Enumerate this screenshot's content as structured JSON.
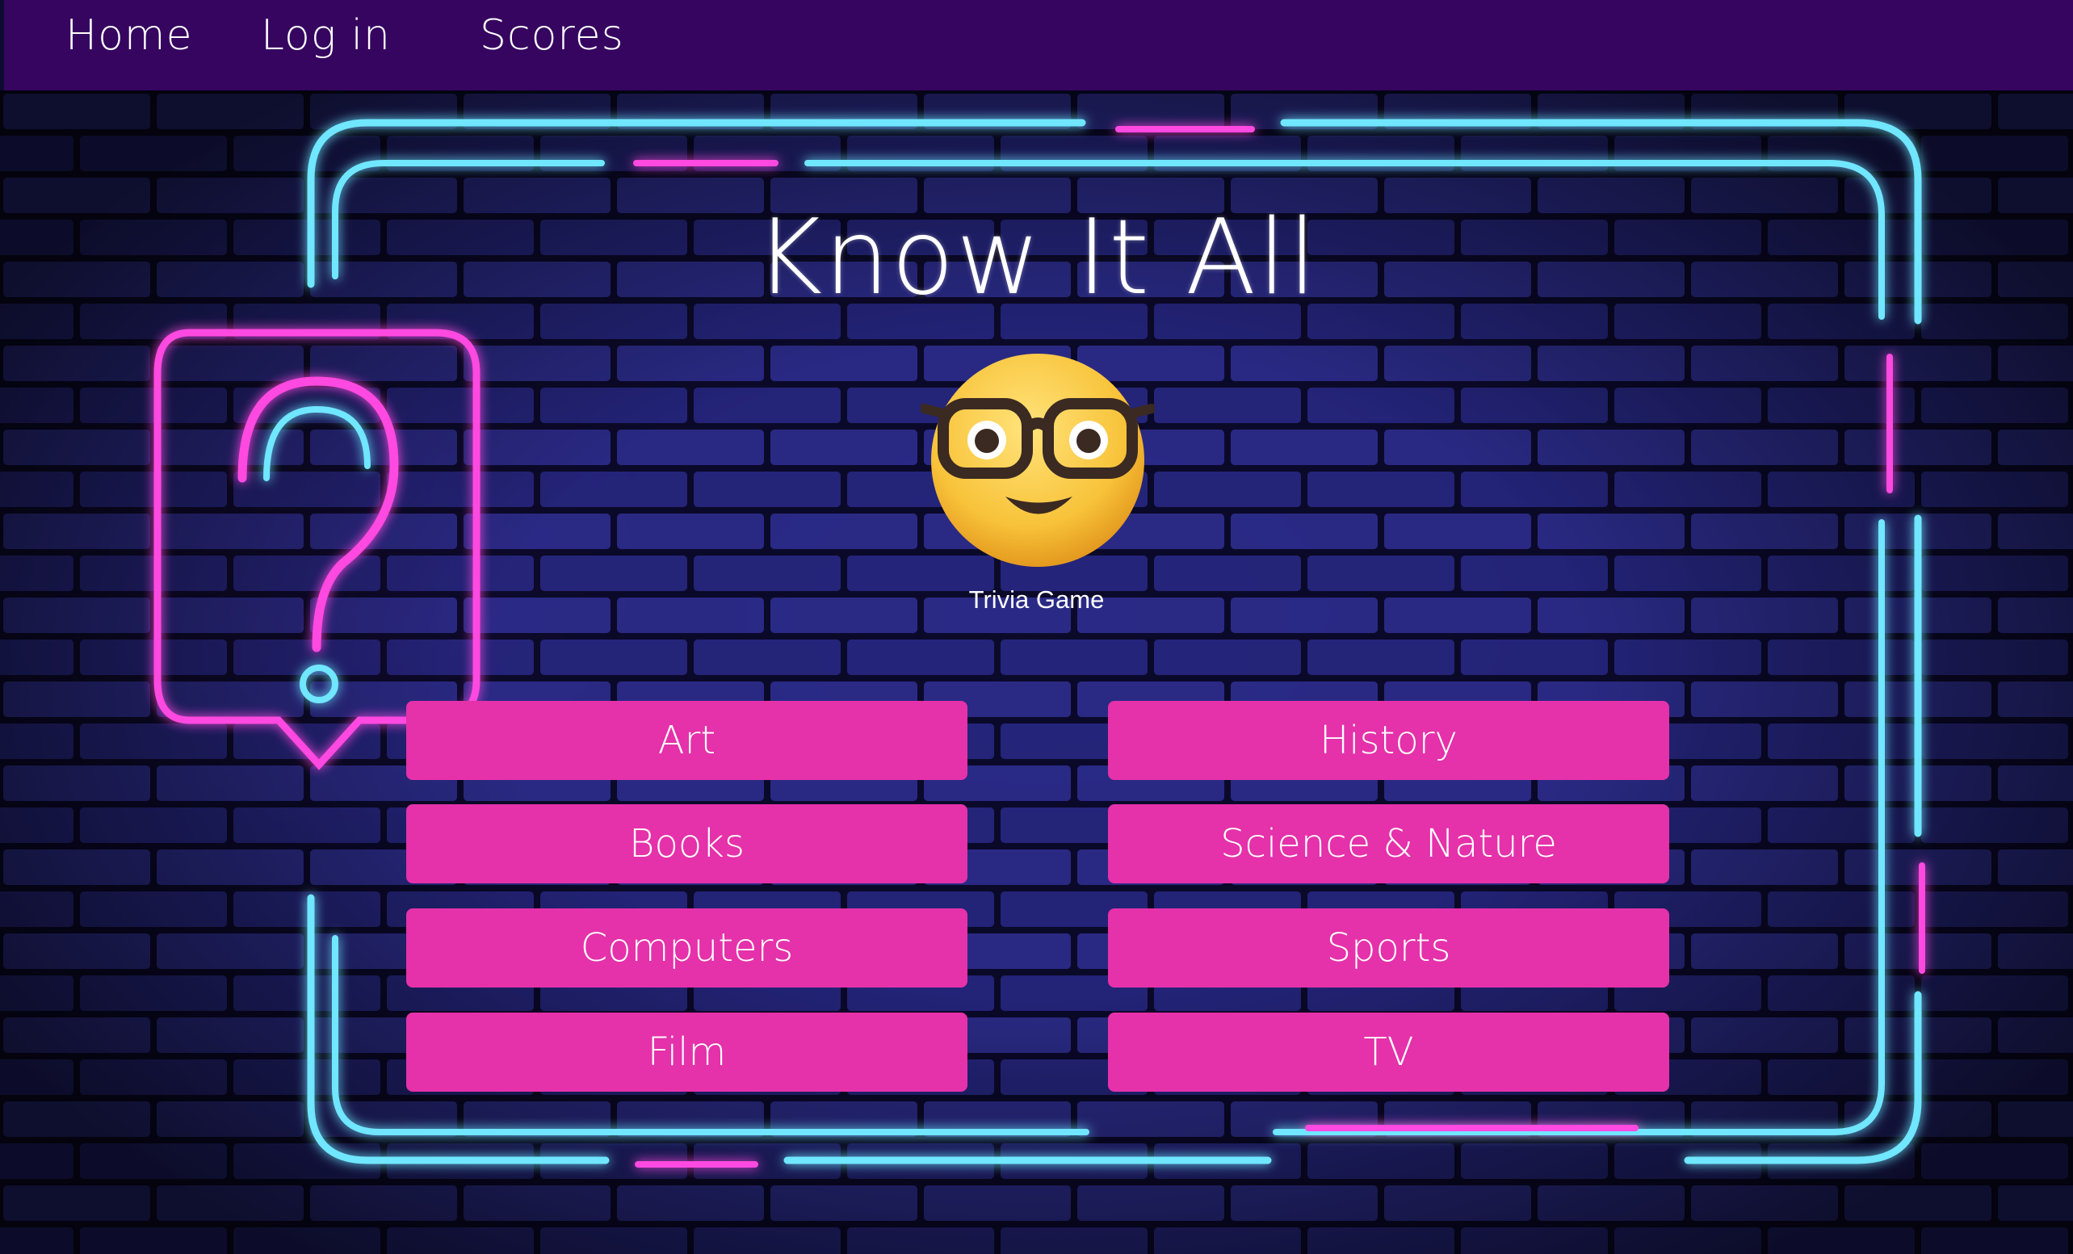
{
  "nav": {
    "items": [
      {
        "label": "Home"
      },
      {
        "label": "Log in"
      },
      {
        "label": "Scores"
      }
    ]
  },
  "hero": {
    "title": "Know It All",
    "logo_icon": "nerd-face-emoji",
    "subtitle": "Trivia Game"
  },
  "categories": [
    {
      "label": "Art"
    },
    {
      "label": "History"
    },
    {
      "label": "Books"
    },
    {
      "label": "Science & Nature"
    },
    {
      "label": "Computers"
    },
    {
      "label": "Sports"
    },
    {
      "label": "Film"
    },
    {
      "label": "TV"
    }
  ],
  "colors": {
    "navbar": "#360560",
    "button": "#e531aa",
    "neon_cyan": "#5fe3ff",
    "neon_magenta": "#ff3ddc"
  }
}
